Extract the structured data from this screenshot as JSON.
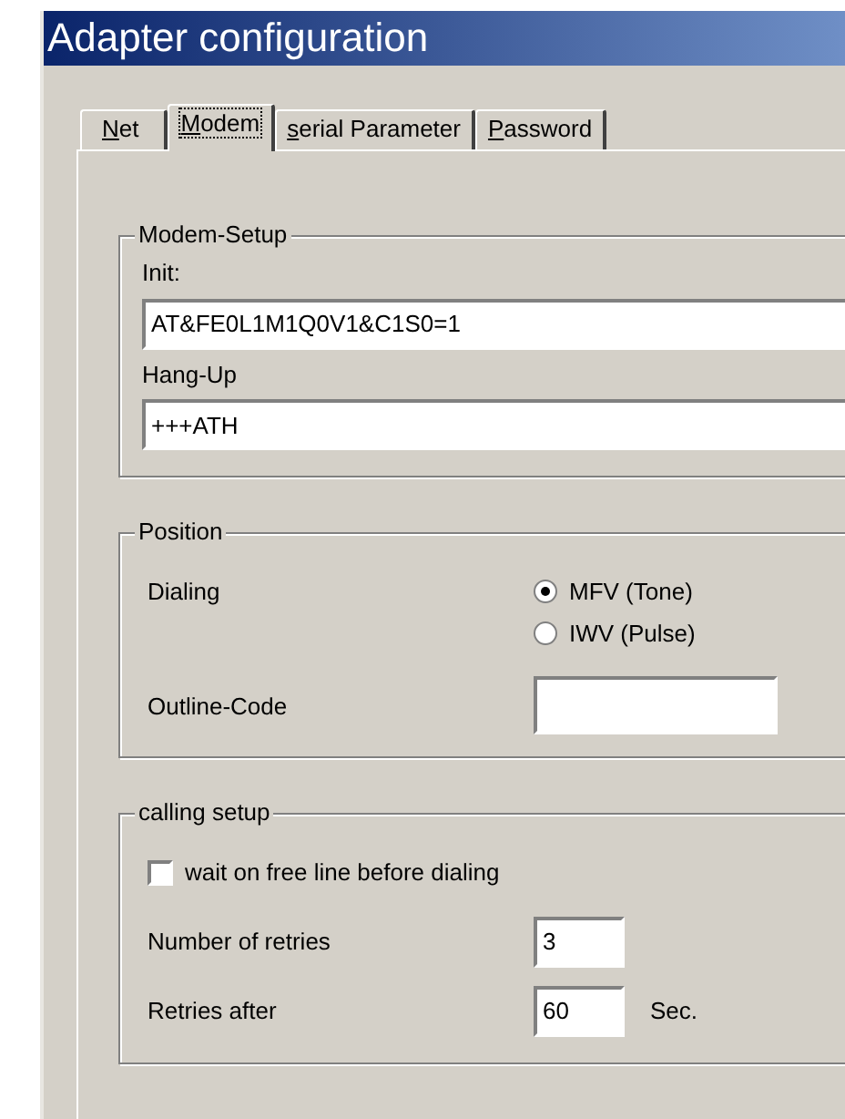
{
  "window": {
    "title": "Adapter configuration"
  },
  "tabs": [
    {
      "mnemonic": "N",
      "label_rest": "et",
      "selected": false
    },
    {
      "mnemonic": "M",
      "label_rest": "odem",
      "selected": true
    },
    {
      "mnemonic": "s",
      "label_rest": "erial Parameter",
      "selected": false
    },
    {
      "mnemonic": "P",
      "label_rest": "assword",
      "selected": false
    }
  ],
  "modem_setup": {
    "title": "Modem-Setup",
    "init": {
      "label": "Init:",
      "value": "AT&FE0L1M1Q0V1&C1S0=1"
    },
    "hang_up": {
      "label": "Hang-Up",
      "value": "+++ATH"
    }
  },
  "position": {
    "title": "Position",
    "dialing": {
      "label": "Dialing",
      "options": [
        {
          "label": "MFV (Tone)",
          "selected": true
        },
        {
          "label": "IWV (Pulse)",
          "selected": false
        }
      ]
    },
    "outline_code": {
      "label": "Outline-Code"
    }
  },
  "calling_setup": {
    "title": "calling setup",
    "wait_free_line": {
      "label": "wait on free line before dialing",
      "checked": false
    },
    "retries": {
      "label": "Number of retries",
      "value": "3"
    },
    "retries_after": {
      "label": "Retries after",
      "value": "60",
      "unit": "Sec."
    }
  }
}
